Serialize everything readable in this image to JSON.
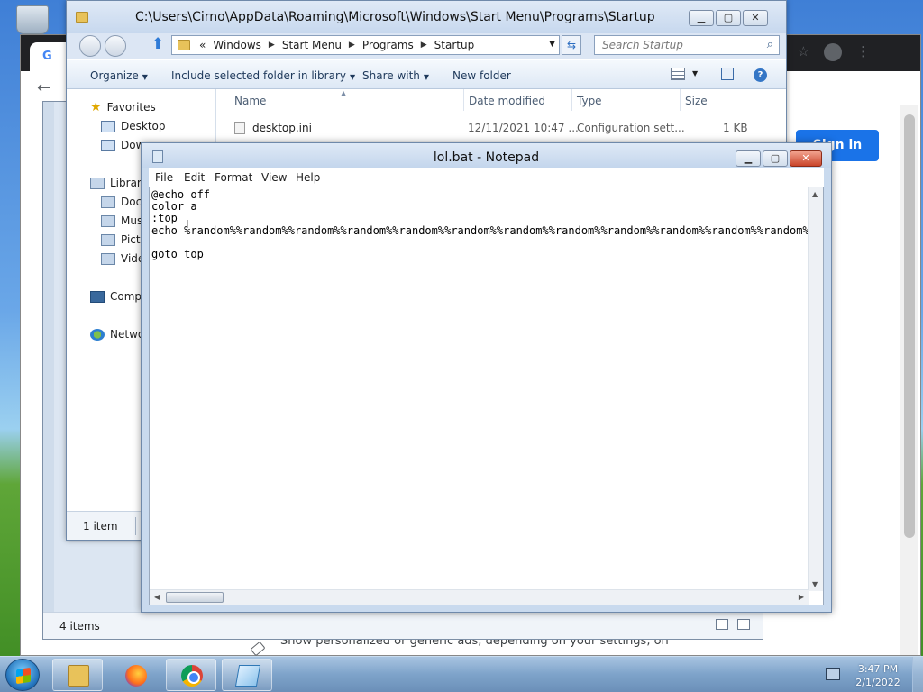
{
  "explorer": {
    "title": "C:\\Users\\Cirno\\AppData\\Roaming\\Microsoft\\Windows\\Start Menu\\Programs\\Startup",
    "breadcrumbs": [
      "«",
      "Windows",
      "Start Menu",
      "Programs",
      "Startup"
    ],
    "search_placeholder": "Search Startup",
    "toolbar": {
      "organize": "Organize",
      "include": "Include selected folder in library",
      "share": "Share with",
      "new_folder": "New folder"
    },
    "nav": {
      "favorites": "Favorites",
      "desktop": "Desktop",
      "downloads": "Dow",
      "libraries": "Librari",
      "documents": "Docu",
      "music": "Mus",
      "pictures": "Pictu",
      "videos": "Vide",
      "computer": "Comp",
      "network": "Netwo"
    },
    "columns": {
      "name": "Name",
      "date": "Date modified",
      "type": "Type",
      "size": "Size"
    },
    "files": [
      {
        "name": "desktop.ini",
        "date": "12/11/2021 10:47 ...",
        "type": "Configuration sett...",
        "size": "1 KB"
      }
    ],
    "status": "1 item"
  },
  "explorer_back": {
    "status": "4 items"
  },
  "notepad": {
    "title": "lol.bat - Notepad",
    "menu": [
      "File",
      "Edit",
      "Format",
      "View",
      "Help"
    ],
    "content": "@echo off\ncolor a\n:top\necho %random%%random%%random%%random%%random%%random%%random%%random%%random%%random%%random%%random%%random%%random%%random%%random%\n\ngoto top"
  },
  "chrome": {
    "signin": "Sign in",
    "bottom_text": "Show personalized or generic ads, depending on your settings, on"
  },
  "taskbar": {
    "time": "3:47 PM",
    "date": "2/1/2022"
  },
  "icons": [
    "recycle-bin-icon",
    "folder-icon",
    "firefox-icon",
    "chrome-icon",
    "notepad-icon",
    "network-tray-icon"
  ]
}
